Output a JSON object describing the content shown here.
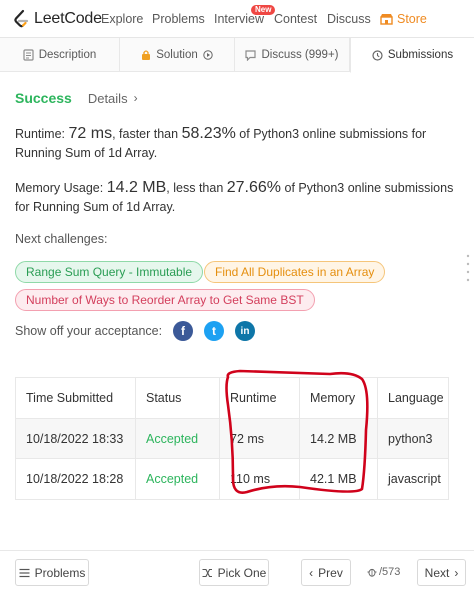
{
  "nav": {
    "logo_text": "LeetCode",
    "items": [
      "Explore",
      "Problems",
      "Interview",
      "Contest",
      "Discuss"
    ],
    "new_badge": "New",
    "store": "Store"
  },
  "tabs": [
    {
      "label": "Description",
      "icon": "document-icon"
    },
    {
      "label": "Solution",
      "icon": "lock-icon"
    },
    {
      "label": "Discuss (999+)",
      "icon": "chat-icon"
    },
    {
      "label": "Submissions",
      "icon": "clock-icon"
    }
  ],
  "result": {
    "status": "Success",
    "details_label": "Details",
    "details_chevron": "›",
    "runtime_prefix": "Runtime: ",
    "runtime_value": "72 ms",
    "runtime_mid": ", faster than ",
    "runtime_pct": "58.23%",
    "runtime_suffix": " of Python3 online submissions for Running Sum of 1d Array.",
    "memory_prefix": "Memory Usage: ",
    "memory_value": "14.2 MB",
    "memory_mid": ", less than ",
    "memory_pct": "27.66%",
    "memory_suffix": " of Python3 online submissions for Running Sum of 1d Array."
  },
  "next_challenges": {
    "label": "Next challenges:",
    "items": [
      {
        "label": "Range Sum Query - Immutable",
        "difficulty": "easy"
      },
      {
        "label": "Find All Duplicates in an Array",
        "difficulty": "medium"
      },
      {
        "label": "Number of Ways to Reorder Array to Get Same BST",
        "difficulty": "hard"
      }
    ]
  },
  "share": {
    "label": "Show off your acceptance:",
    "icons": [
      "facebook-icon",
      "twitter-icon",
      "linkedin-icon"
    ],
    "glyphs": [
      "f",
      "t",
      "in"
    ],
    "colors": [
      "#3b5998",
      "#1da1f2",
      "#0e76a8"
    ]
  },
  "table": {
    "headers": [
      "Time Submitted",
      "Status",
      "Runtime",
      "Memory",
      "Language"
    ],
    "rows": [
      [
        "10/18/2022 18:33",
        "Accepted",
        "72 ms",
        "14.2 MB",
        "python3"
      ],
      [
        "10/18/2022 18:28",
        "Accepted",
        "110 ms",
        "42.1 MB",
        "javascript"
      ]
    ]
  },
  "footer": {
    "problems": "Problems",
    "pick_one": "Pick One",
    "prev": "Prev",
    "counter": "/573",
    "next": "Next"
  },
  "colors": {
    "success": "#2db55d",
    "annotation": "#d0021b",
    "store": "#ef8b22"
  }
}
